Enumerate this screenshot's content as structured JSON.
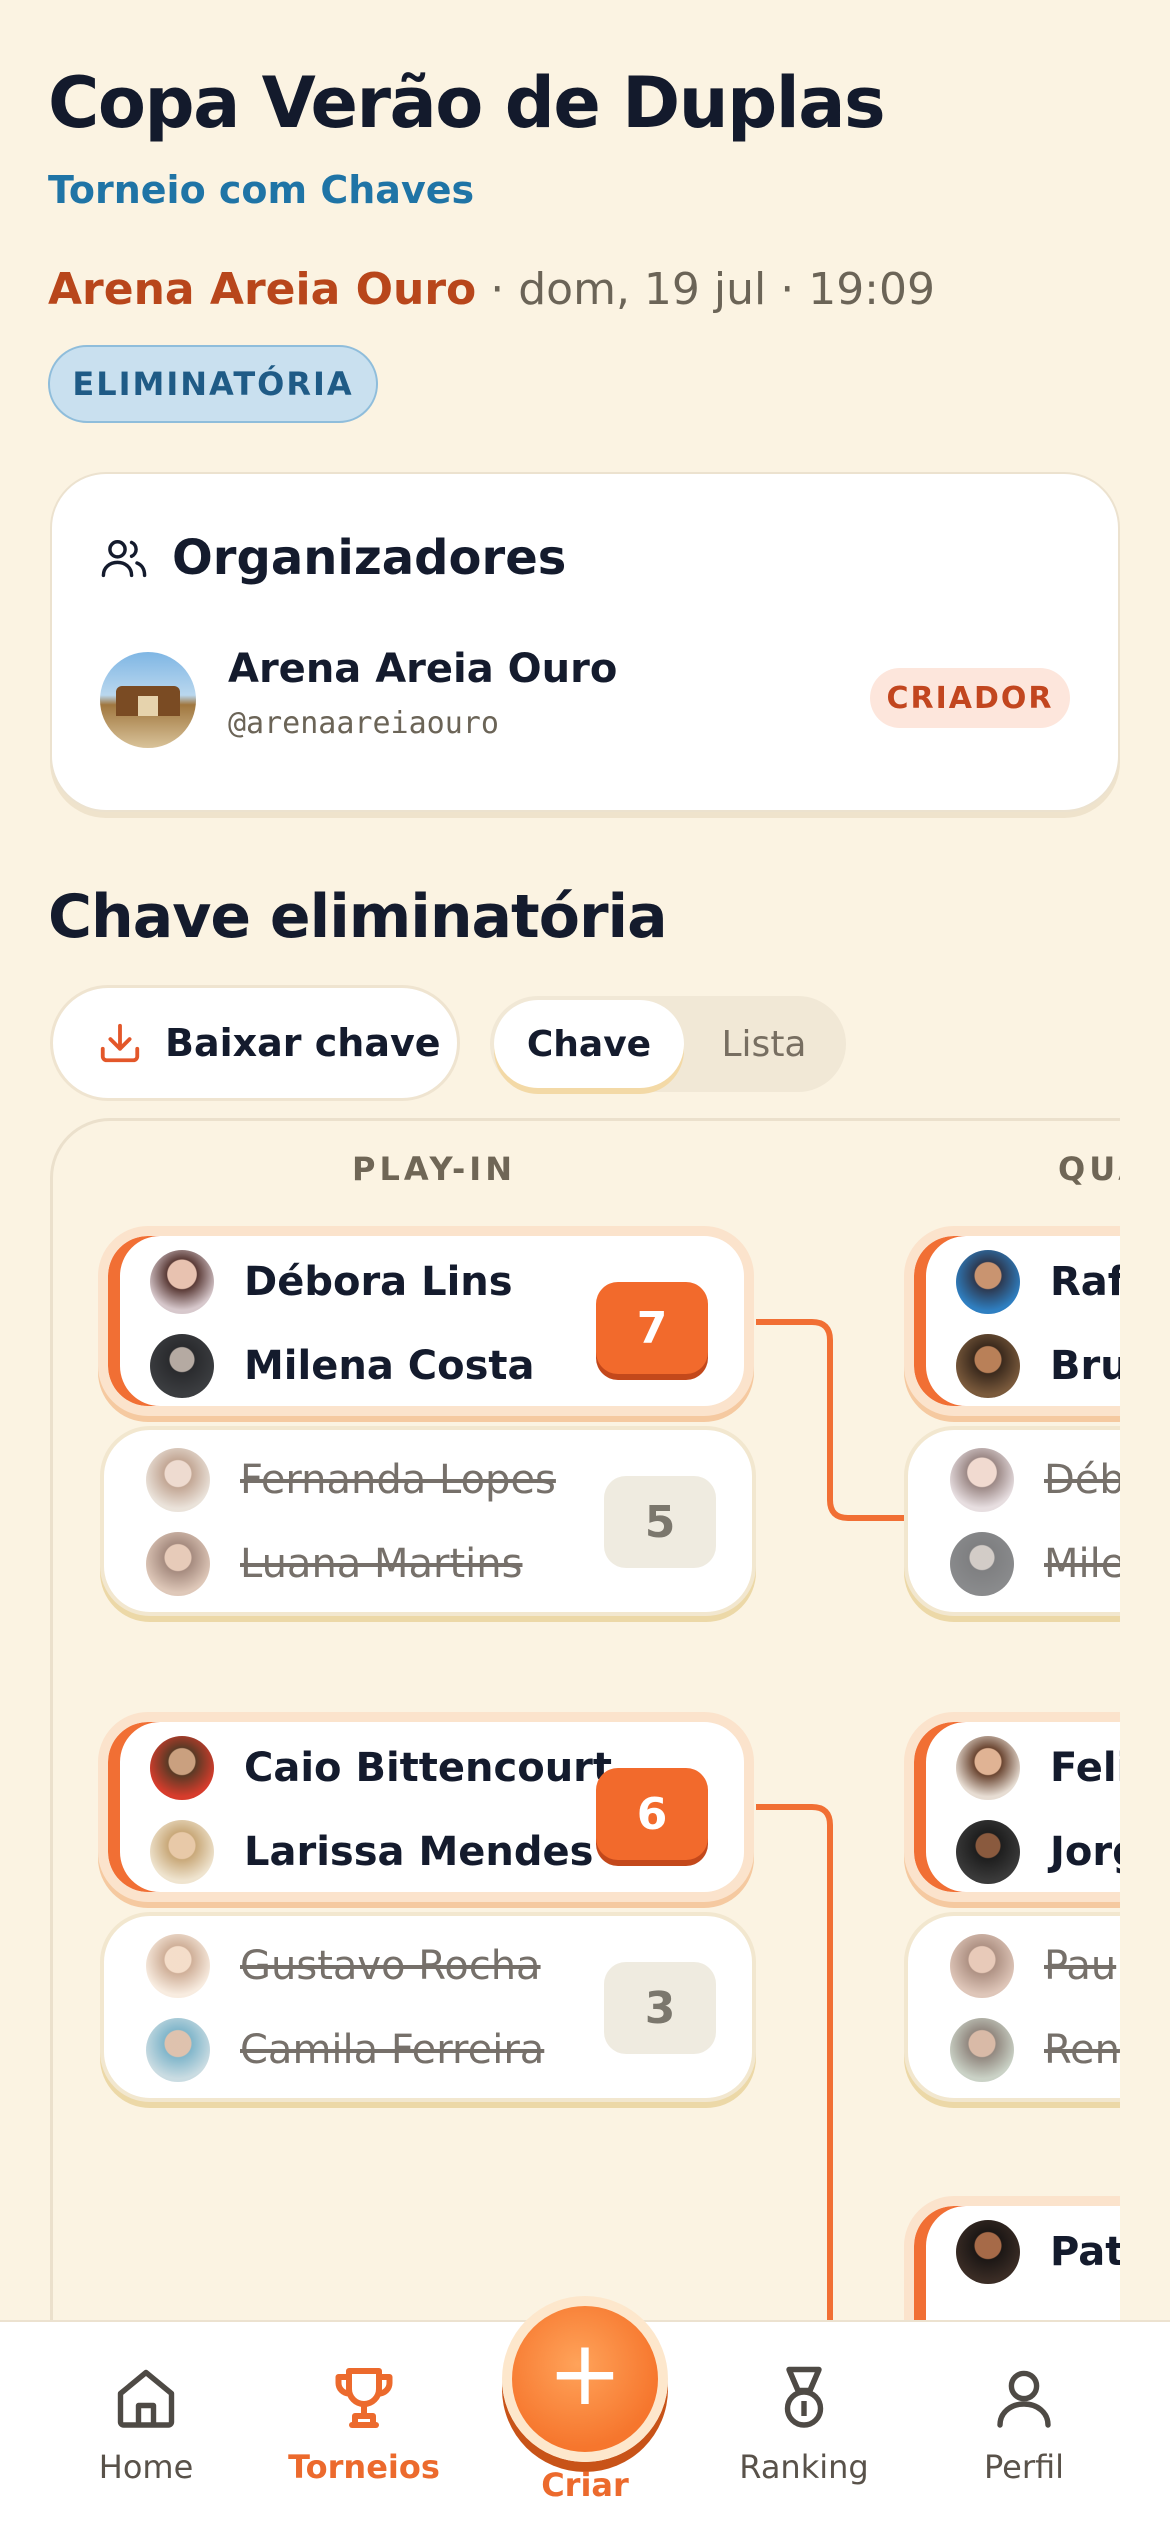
{
  "header": {
    "title": "Copa Verão de Duplas",
    "subtitle": "Torneio com Chaves",
    "venue": "Arena Areia Ouro",
    "date": " · dom, 19 jul · 19:09",
    "badge": "ELIMINATÓRIA"
  },
  "organizers": {
    "heading": "Organizadores",
    "name": "Arena Areia Ouro",
    "handle": "@arenaareiaouro",
    "role": "CRIADOR"
  },
  "bracket": {
    "title": "Chave eliminatória",
    "download_label": "Baixar chave",
    "view_tabs": [
      "Chave",
      "Lista"
    ],
    "selected_tab": "Chave",
    "rounds": [
      "PLAY-IN",
      "QUA"
    ],
    "playin": [
      {
        "winner": {
          "p1": "Débora Lins",
          "p2": "Milena Costa",
          "score": "7"
        },
        "loser": {
          "p1": "Fernanda Lopes",
          "p2": "Luana Martins",
          "score": "5"
        }
      },
      {
        "winner": {
          "p1": "Caio Bittencourt",
          "p2": "Larissa Mendes",
          "score": "6"
        },
        "loser": {
          "p1": "Gustavo Rocha",
          "p2": "Camila Ferreira",
          "score": "3"
        }
      }
    ],
    "quarter_visible": [
      {
        "top": {
          "p1": "Rafa",
          "p2": "Brun"
        },
        "bottom": {
          "p1": "Déb",
          "p2": "Mile"
        }
      },
      {
        "top": {
          "p1": "Felip",
          "p2": "Jorg"
        },
        "bottom": {
          "p1": "Pau",
          "p2": "Ren"
        }
      },
      {
        "top": {
          "p1": "Patr",
          "p2": ""
        }
      }
    ],
    "accent_color": "#f16f34"
  },
  "nav": {
    "items": [
      "Home",
      "Torneios",
      "Criar",
      "Ranking",
      "Perfil"
    ],
    "active": "Torneios"
  }
}
